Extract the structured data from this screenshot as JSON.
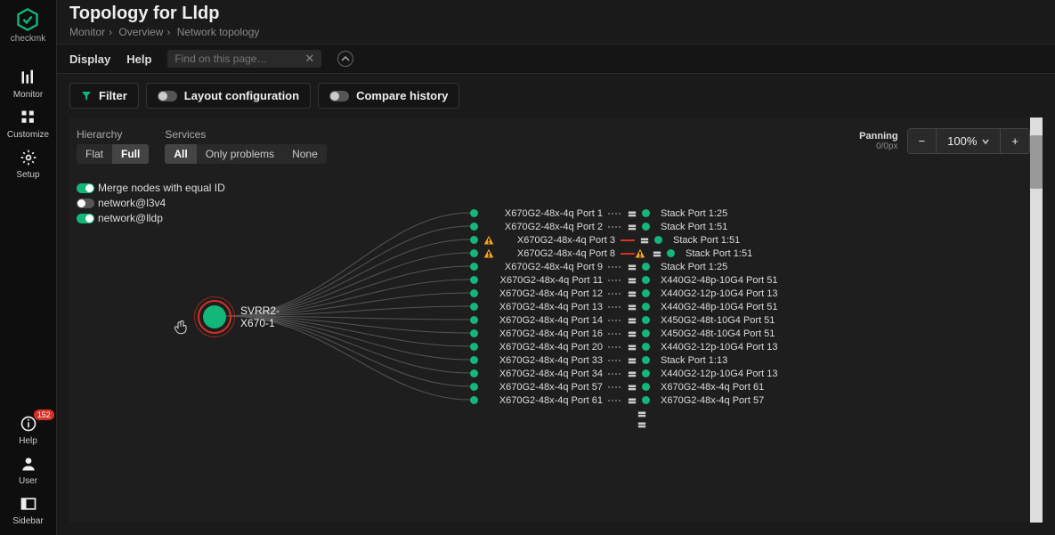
{
  "logo_text": "checkmk",
  "sidebar_top": [
    {
      "name": "monitor",
      "label": "Monitor",
      "icon": "bars"
    },
    {
      "name": "customize",
      "label": "Customize",
      "icon": "grid"
    },
    {
      "name": "setup",
      "label": "Setup",
      "icon": "gear"
    }
  ],
  "sidebar_bottom": [
    {
      "name": "help",
      "label": "Help",
      "icon": "info",
      "badge": "152"
    },
    {
      "name": "user",
      "label": "User",
      "icon": "user"
    },
    {
      "name": "sidebar-toggle",
      "label": "Sidebar",
      "icon": "panel"
    }
  ],
  "title": "Topology for Lldp",
  "breadcrumb": [
    "Monitor",
    "Overview",
    "Network topology"
  ],
  "menu": {
    "display": "Display",
    "help": "Help"
  },
  "search_placeholder": "Find on this page…",
  "toolbar": {
    "filter": "Filter",
    "layout": "Layout configuration",
    "compare": "Compare history"
  },
  "hierarchy": {
    "label": "Hierarchy",
    "flat": "Flat",
    "full": "Full",
    "active": "full"
  },
  "services": {
    "label": "Services",
    "all": "All",
    "only": "Only problems",
    "none": "None",
    "active": "all"
  },
  "toggles": [
    {
      "label": "Merge nodes with equal ID",
      "on": true
    },
    {
      "label": "network@l3v4",
      "on": false
    },
    {
      "label": "network@lldp",
      "on": true
    }
  ],
  "panning": {
    "label": "Panning",
    "value": "0/0px"
  },
  "zoom": "100%",
  "root_node": "SVRR2-X670-1",
  "links": [
    {
      "left": "X670G2-48x-4q Port 1",
      "right": "Stack Port 1:25",
      "status": "ok"
    },
    {
      "left": "X670G2-48x-4q Port 2",
      "right": "Stack Port 1:51",
      "status": "ok"
    },
    {
      "left": "X670G2-48x-4q Port 3",
      "right": "Stack Port 1:51",
      "status": "warn_left"
    },
    {
      "left": "X670G2-48x-4q Port 8",
      "right": "Stack Port 1:51",
      "status": "warn_both"
    },
    {
      "left": "X670G2-48x-4q Port 9",
      "right": "Stack Port 1:25",
      "status": "ok"
    },
    {
      "left": "X670G2-48x-4q Port 11",
      "right": "X440G2-48p-10G4 Port 51",
      "status": "ok"
    },
    {
      "left": "X670G2-48x-4q Port 12",
      "right": "X440G2-12p-10G4 Port 13",
      "status": "ok"
    },
    {
      "left": "X670G2-48x-4q Port 13",
      "right": "X440G2-48p-10G4 Port 51",
      "status": "ok"
    },
    {
      "left": "X670G2-48x-4q Port 14",
      "right": "X450G2-48t-10G4 Port 51",
      "status": "ok"
    },
    {
      "left": "X670G2-48x-4q Port 16",
      "right": "X450G2-48t-10G4 Port 51",
      "status": "ok"
    },
    {
      "left": "X670G2-48x-4q Port 20",
      "right": "X440G2-12p-10G4 Port 13",
      "status": "ok"
    },
    {
      "left": "X670G2-48x-4q Port 33",
      "right": "Stack Port 1:13",
      "status": "ok"
    },
    {
      "left": "X670G2-48x-4q Port 34",
      "right": "X440G2-12p-10G4 Port 13",
      "status": "ok"
    },
    {
      "left": "X670G2-48x-4q Port 57",
      "right": "X670G2-48x-4q Port 61",
      "status": "ok"
    },
    {
      "left": "X670G2-48x-4q Port 61",
      "right": "X670G2-48x-4q Port 57",
      "status": "ok"
    }
  ]
}
